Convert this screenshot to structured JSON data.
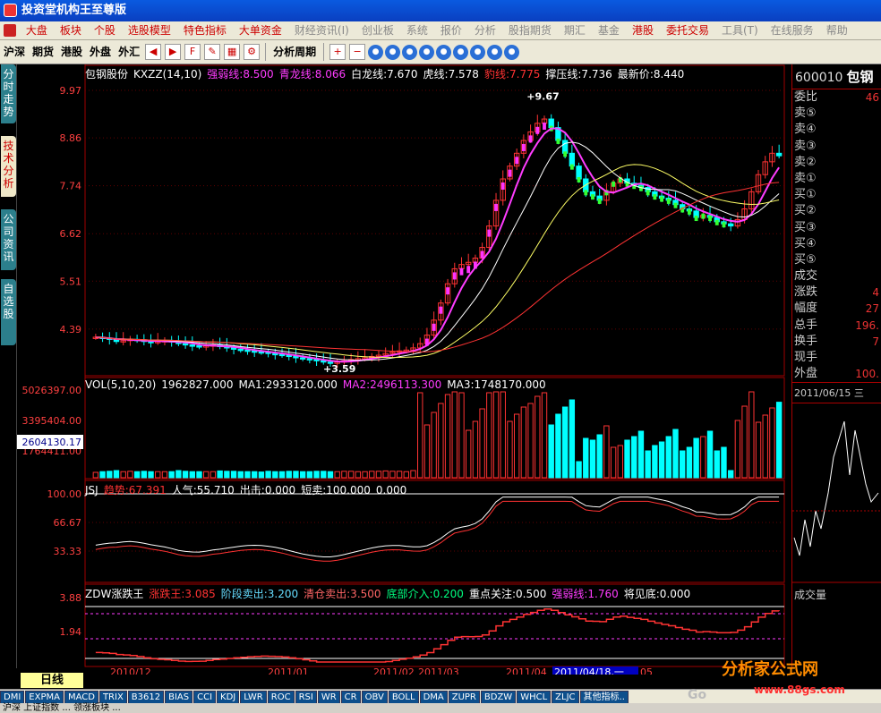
{
  "window_title": "投资堂机构王至尊版",
  "menu": [
    "大盘",
    "板块",
    "个股",
    "选股模型",
    "特色指标",
    "大单资金",
    "财经资讯(I)",
    "创业板",
    "系统",
    "报价",
    "分析",
    "股指期货",
    "期汇",
    "基金",
    "港股",
    "委托交易",
    "工具(T)",
    "在线服务",
    "帮助"
  ],
  "toolbar": {
    "markets": [
      "沪深",
      "期货",
      "港股",
      "外盘",
      "外汇"
    ],
    "period_label": "分析周期"
  },
  "side_tabs": [
    "分时走势",
    "技术分析",
    "公司资讯",
    "自选股"
  ],
  "main_header": {
    "stock": "包钢股份",
    "indicator": "KXZZ(14,10)",
    "items": [
      {
        "label": "强弱线",
        "value": "8.500",
        "color": "#ff3cff"
      },
      {
        "label": "青龙线",
        "value": "8.066",
        "color": "#ff3cff"
      },
      {
        "label": "白龙线",
        "value": "7.670",
        "color": "#ffffff"
      },
      {
        "label": "虎线",
        "value": "7.578",
        "color": "#ffffff"
      },
      {
        "label": "豹线",
        "value": "7.775",
        "color": "#ff3333"
      },
      {
        "label": "撑压线",
        "value": "7.736",
        "color": "#ffffff"
      },
      {
        "label": "最新价",
        "value": "8.440",
        "color": "#ffffff"
      }
    ]
  },
  "price_axis": [
    "9.97",
    "8.86",
    "7.74",
    "6.62",
    "5.51",
    "4.39"
  ],
  "price_annotations": {
    "high": "9.67",
    "low": "3.59"
  },
  "vol_header": {
    "name": "VOL(5,10,20)",
    "value": "1962827.000",
    "ma1": "MA1:2933120.000",
    "ma2": "MA2:2496113.300",
    "ma3": "MA3:1748170.000"
  },
  "vol_axis": [
    "5026397.00",
    "3395404.00",
    "1764411.00"
  ],
  "vol_cursor": "2604130.17",
  "jsj_header": {
    "name": "JSJ",
    "trend_label": "趋势:",
    "trend": "67.391",
    "pop": "人气:55.710",
    "out": "出击:0.000",
    "short": "短卖:100.000",
    "extra": "0.000"
  },
  "jsj_axis": [
    "100.00",
    "66.67",
    "33.33"
  ],
  "zdw_header": {
    "name": "ZDW涨跌王",
    "a": "涨跌王:3.085",
    "b": "阶段卖出:3.200",
    "c": "清仓卖出:3.500",
    "d": "底部介入:0.200",
    "e": "重点关注:0.500",
    "f": "强弱线:1.760",
    "g": "将见底:0.000"
  },
  "zdw_axis": [
    "3.88",
    "1.94"
  ],
  "date_axis": [
    "2010/12",
    "2011/01",
    "2011/02",
    "2011/03",
    "2011/04",
    "2011/04/18,一",
    "05"
  ],
  "period_button": "日线",
  "indicator_tabs": [
    "DMI",
    "EXPMA",
    "MACD",
    "TRIX",
    "B3612",
    "BIAS",
    "CCI",
    "KDJ",
    "LWR",
    "ROC",
    "RSI",
    "WR",
    "CR",
    "OBV",
    "BOLL",
    "DMA",
    "ZUPR",
    "BDZW",
    "WHCL",
    "ZLJC",
    "其他指标.."
  ],
  "quote": {
    "code": "600010",
    "name": "包钢",
    "rows": [
      {
        "label": "委比",
        "value": "46"
      },
      {
        "label": "卖⑤",
        "value": ""
      },
      {
        "label": "卖④",
        "value": ""
      },
      {
        "label": "卖③",
        "value": ""
      },
      {
        "label": "卖②",
        "value": ""
      },
      {
        "label": "卖①",
        "value": ""
      },
      {
        "label": "买①",
        "value": ""
      },
      {
        "label": "买②",
        "value": ""
      },
      {
        "label": "买③",
        "value": ""
      },
      {
        "label": "买④",
        "value": ""
      },
      {
        "label": "买⑤",
        "value": ""
      },
      {
        "label": "成交",
        "value": ""
      },
      {
        "label": "涨跌",
        "value": "4"
      },
      {
        "label": "幅度",
        "value": "27"
      },
      {
        "label": "总手",
        "value": "196."
      },
      {
        "label": "换手",
        "value": "7"
      },
      {
        "label": "现手",
        "value": ""
      },
      {
        "label": "外盘",
        "value": "100."
      }
    ],
    "date": "2011/06/15 三",
    "volume_label": "成交量"
  },
  "watermark": {
    "name": "分析家公式网",
    "url": "www.88gs.com",
    "left": "Go"
  },
  "bottom_text": "沪深  上证指数  ... 领涨板块 ...",
  "chart_data": {
    "type": "candlestick",
    "ylim": [
      3.3,
      10.2
    ],
    "close": [
      4.2,
      4.18,
      4.15,
      4.1,
      4.12,
      4.15,
      4.13,
      4.1,
      4.08,
      4.1,
      4.12,
      4.1,
      4.05,
      4.02,
      4.0,
      3.98,
      4.0,
      4.02,
      3.98,
      3.95,
      3.92,
      3.9,
      3.88,
      3.86,
      3.85,
      3.82,
      3.8,
      3.78,
      3.75,
      3.72,
      3.7,
      3.68,
      3.65,
      3.62,
      3.6,
      3.62,
      3.65,
      3.68,
      3.7,
      3.72,
      3.75,
      3.78,
      3.82,
      3.85,
      3.88,
      3.9,
      3.95,
      4.05,
      4.25,
      4.6,
      5.0,
      5.45,
      5.8,
      5.9,
      5.95,
      6.05,
      6.3,
      6.8,
      7.4,
      7.9,
      8.2,
      8.5,
      8.8,
      9.0,
      9.2,
      9.3,
      9.1,
      8.8,
      8.5,
      8.2,
      7.9,
      7.6,
      7.5,
      7.4,
      7.6,
      7.8,
      7.9,
      7.8,
      7.75,
      7.7,
      7.6,
      7.5,
      7.45,
      7.4,
      7.3,
      7.2,
      7.15,
      7.0,
      7.05,
      7.0,
      6.9,
      6.85,
      6.8,
      6.95,
      7.2,
      7.6,
      8.0,
      8.3,
      8.5,
      8.44
    ],
    "ma_short": "white",
    "ma_mid": "yellow",
    "ma_long": "red"
  }
}
